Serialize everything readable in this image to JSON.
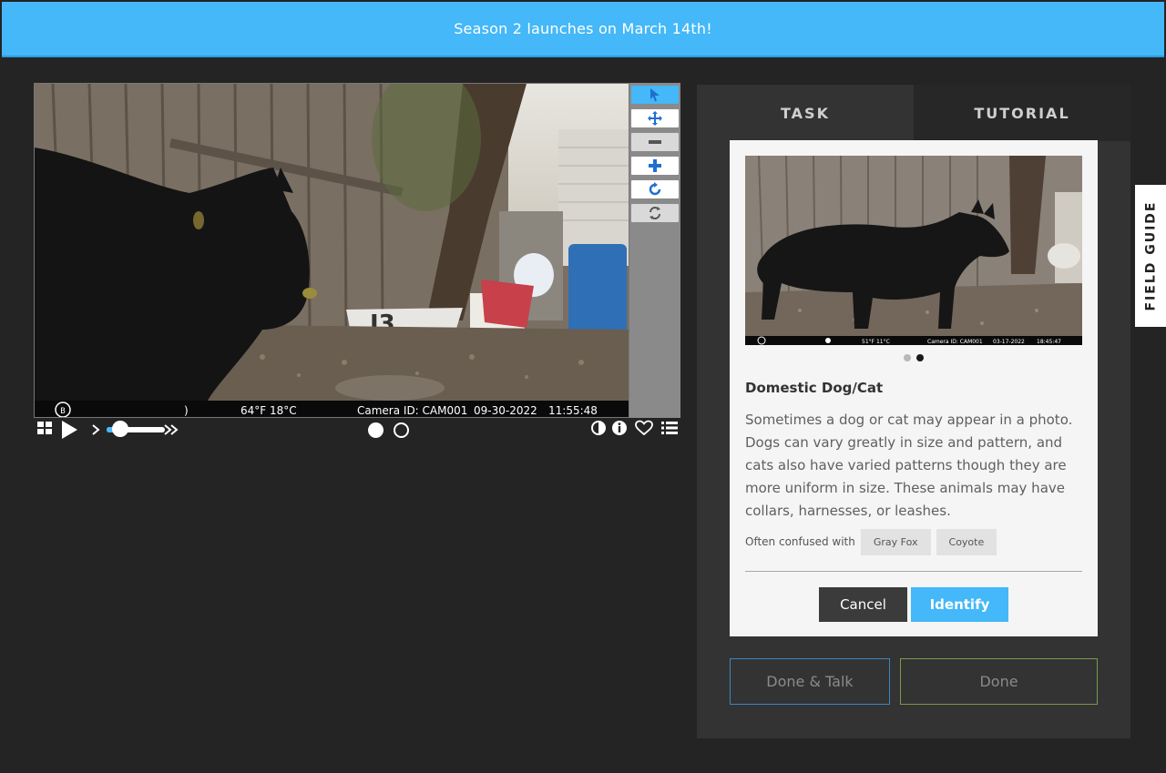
{
  "banner": {
    "text": "Season 2 launches on March 14th!"
  },
  "viewer": {
    "overlay": {
      "temperature": "64°F  18°C",
      "camera_id": "Camera ID: CAM001",
      "date": "09-30-2022",
      "time": "11:55:48",
      "moon": ")"
    },
    "toolbar": [
      "pointer-icon",
      "move-icon",
      "zoom-out-icon",
      "zoom-in-icon",
      "rotate-icon",
      "reset-icon"
    ],
    "controls": {
      "left": [
        "grid-icon",
        "play-icon",
        "slow-icon",
        "fast-icon"
      ],
      "frames": 2,
      "selected_frame": 0,
      "right": [
        "invert-icon",
        "info-icon",
        "heart-icon",
        "list-icon"
      ]
    }
  },
  "panel": {
    "tabs": [
      {
        "label": "TASK",
        "active": true
      },
      {
        "label": "TUTORIAL",
        "active": false
      }
    ],
    "card": {
      "photo_overlay": {
        "temperature": "51°F  11°C",
        "camera_id": "Camera ID: CAM001",
        "date": "03-17-2022",
        "time": "18:45:47"
      },
      "image_count": 2,
      "active_image": 1,
      "title": "Domestic Dog/Cat",
      "description": "Sometimes a dog or cat may appear in a photo. Dogs can vary greatly in size and pattern, and cats also have varied patterns though they are more uniform in size. These animals may have collars, harnesses, or leashes.",
      "confused_label": "Often confused with",
      "confused_with": [
        "Gray Fox",
        "Coyote"
      ],
      "cancel_label": "Cancel",
      "identify_label": "Identify"
    },
    "done_talk_label": "Done & Talk",
    "done_label": "Done"
  },
  "field_guide": {
    "label": "FIELD GUIDE"
  },
  "colors": {
    "accent": "#44b8f8",
    "background": "#242424",
    "panel": "#333333"
  }
}
